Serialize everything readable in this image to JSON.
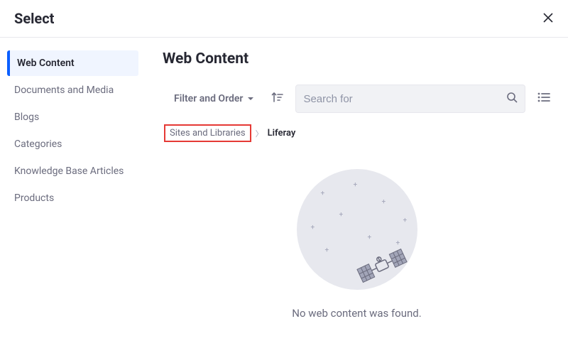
{
  "header": {
    "title": "Select"
  },
  "sidebar": {
    "items": [
      {
        "label": "Web Content",
        "active": true
      },
      {
        "label": "Documents and Media",
        "active": false
      },
      {
        "label": "Blogs",
        "active": false
      },
      {
        "label": "Categories",
        "active": false
      },
      {
        "label": "Knowledge Base Articles",
        "active": false
      },
      {
        "label": "Products",
        "active": false
      }
    ]
  },
  "main": {
    "title": "Web Content",
    "filter_label": "Filter and Order",
    "search_placeholder": "Search for",
    "breadcrumb": {
      "root": "Sites and Libraries",
      "current": "Liferay"
    },
    "empty_message": "No web content was found."
  }
}
